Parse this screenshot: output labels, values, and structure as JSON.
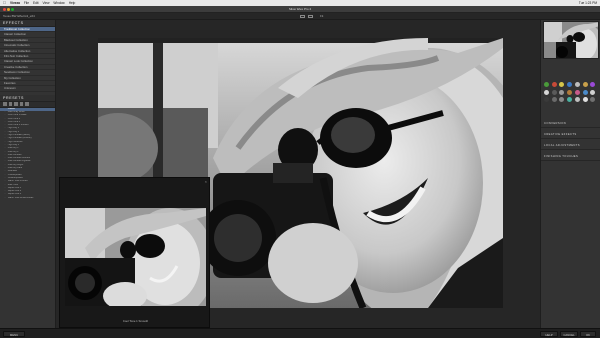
{
  "menubar": {
    "app": "Viveza",
    "items": [
      "File",
      "Edit",
      "View",
      "Window",
      "Help"
    ],
    "status": "Tue 1:23 PM"
  },
  "window": {
    "title": "Silver Efex Pro 2"
  },
  "file_tab": {
    "label": "Texas BW Effects3_e64"
  },
  "toolbar": {
    "zoom": "Fit"
  },
  "effects": {
    "title": "EFFECTS",
    "collections": [
      "Traditional Collection",
      "Classic Collection",
      "Blackout Collection",
      "Cinematic Collection",
      "Alternative Collection",
      "Film Noir Collection",
      "Classic Look Collection",
      "Creative Collection",
      "Newbaron Collection",
      "My Collection",
      "Favorites",
      "Unknown"
    ],
    "selected_index": 0
  },
  "presets": {
    "title": "PRESETS",
    "items": [
      "Classic",
      "Dark Gray Down",
      "Cool Tone 1 Matte",
      "Cool Tone 2",
      "Cool Tone 3",
      "Cool Tone 4 Smooth",
      "High Key 1",
      "High Key 2",
      "High Contrast (harsh)",
      "High Contrast (smooth)",
      "High Structure",
      "High Key 3",
      "Low Key 1",
      "Low Key 2",
      "Low Contrast",
      "Low Contrast Contour",
      "Low Contrast Vignette",
      "Low Key Bright",
      "Low Key Dark",
      "Dramatic",
      "Overexposed",
      "Underexposed",
      "Warm Tone Portrait",
      "Blue Tone",
      "Sepia Tone 1",
      "Sepia Tone 2",
      "Sepia Tone 3",
      "Warm Tone White Border"
    ],
    "selected_index": 0
  },
  "popup": {
    "caption": "Cool Tone 1 Smooth"
  },
  "right_panel": {
    "icon_colors": [
      "#4a9a3a",
      "#c74a38",
      "#d6c54a",
      "#3a78c4",
      "#bdbdbd",
      "#c8a04a",
      "#9a4ad6",
      "#d6d6d6",
      "#5a5a5a",
      "#9a9a9a",
      "#b07a3a",
      "#c85a8a",
      "#4a8ac8",
      "#d0d0d0",
      "#3a3a3a",
      "#6a6a6a",
      "#8a8a8a",
      "#4ab0a0",
      "#c0c0c0",
      "#e0e0e0",
      "#707070"
    ],
    "sections": [
      "CONVERSION",
      "CREATIVE EFFECTS",
      "LOCAL ADJUSTMENTS",
      "FINISHING TOUCHES"
    ]
  },
  "bottom": {
    "left_btn": "MENU",
    "help": "HELP",
    "cancel": "CANCEL",
    "ok": "OK"
  }
}
